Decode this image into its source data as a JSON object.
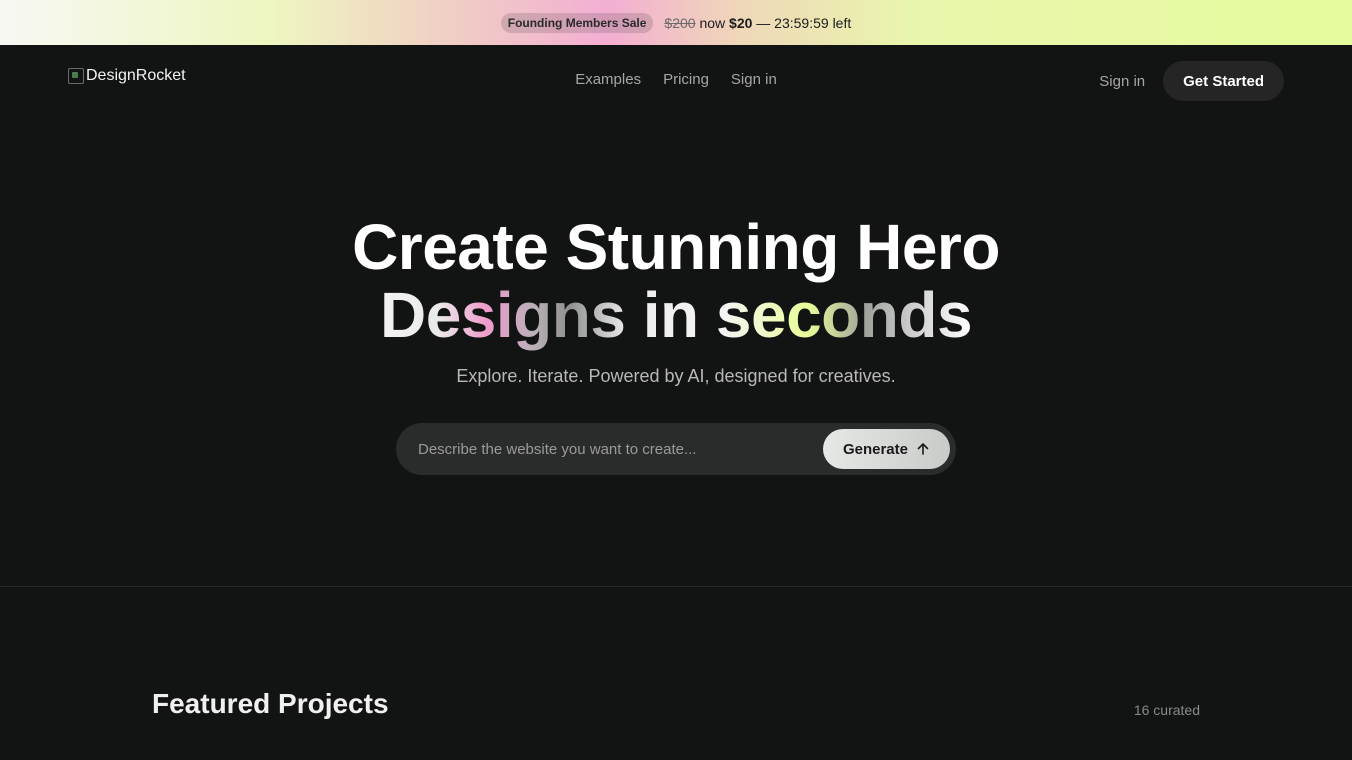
{
  "banner": {
    "badge": "Founding Members Sale",
    "old_price": "$200",
    "now_label": "now",
    "new_price": "$20",
    "countdown": "— 23:59:59 left"
  },
  "nav": {
    "logo_alt": "DesignRocket",
    "links": [
      "Examples",
      "Pricing",
      "Sign in"
    ],
    "sign_in": "Sign in",
    "get_started": "Get Started"
  },
  "hero": {
    "title_line1": "Create Stunning Hero",
    "title_line2": "Designs in seconds",
    "subtitle": "Explore. Iterate. Powered by AI, designed for creatives.",
    "prompt_placeholder": "Describe the website you want to create...",
    "generate_label": "Generate",
    "generate_icon": "arrow-up-icon"
  },
  "featured": {
    "title": "Featured Projects",
    "count": "16 curated"
  },
  "colors": {
    "background": "#121313",
    "button_dark": "#252525",
    "input_bg": "#2a2b2b"
  }
}
